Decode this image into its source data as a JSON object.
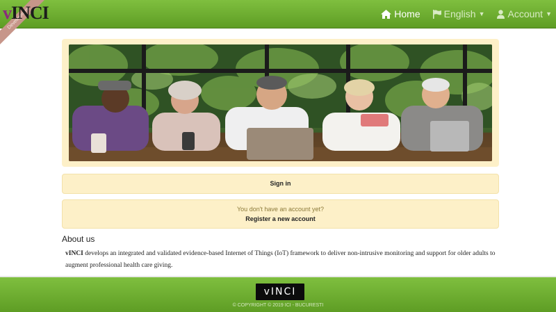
{
  "brand": {
    "logo_v": "v",
    "logo_rest": "INCI",
    "ribbon_text": "Development",
    "colors": {
      "nav_green": "#6aa92d",
      "panel_cream": "#fdf0c8",
      "logo_purple": "#8a2c7b"
    }
  },
  "nav": {
    "home": {
      "label": "Home",
      "icon": "home-icon"
    },
    "language": {
      "label": "English",
      "icon": "flag-icon"
    },
    "account": {
      "label": "Account",
      "icon": "user-icon"
    }
  },
  "main": {
    "hero_image": "Five seniors using phones, tablets and a laptop at a table",
    "signin_label": "Sign in",
    "no_account_text": "You don't have an account yet?",
    "register_label": "Register a new account"
  },
  "about": {
    "title": "About us",
    "brand_bold": "vINCI",
    "text": " develops an integrated and validated evidence-based Internet of Things (IoT) framework to deliver non-intrusive monitoring and support for older adults to augment professional health care giving."
  },
  "footer": {
    "logo": "vINCI",
    "copyright": "© COPYRIGHT © 2019 ICI - BUCURESTI"
  }
}
